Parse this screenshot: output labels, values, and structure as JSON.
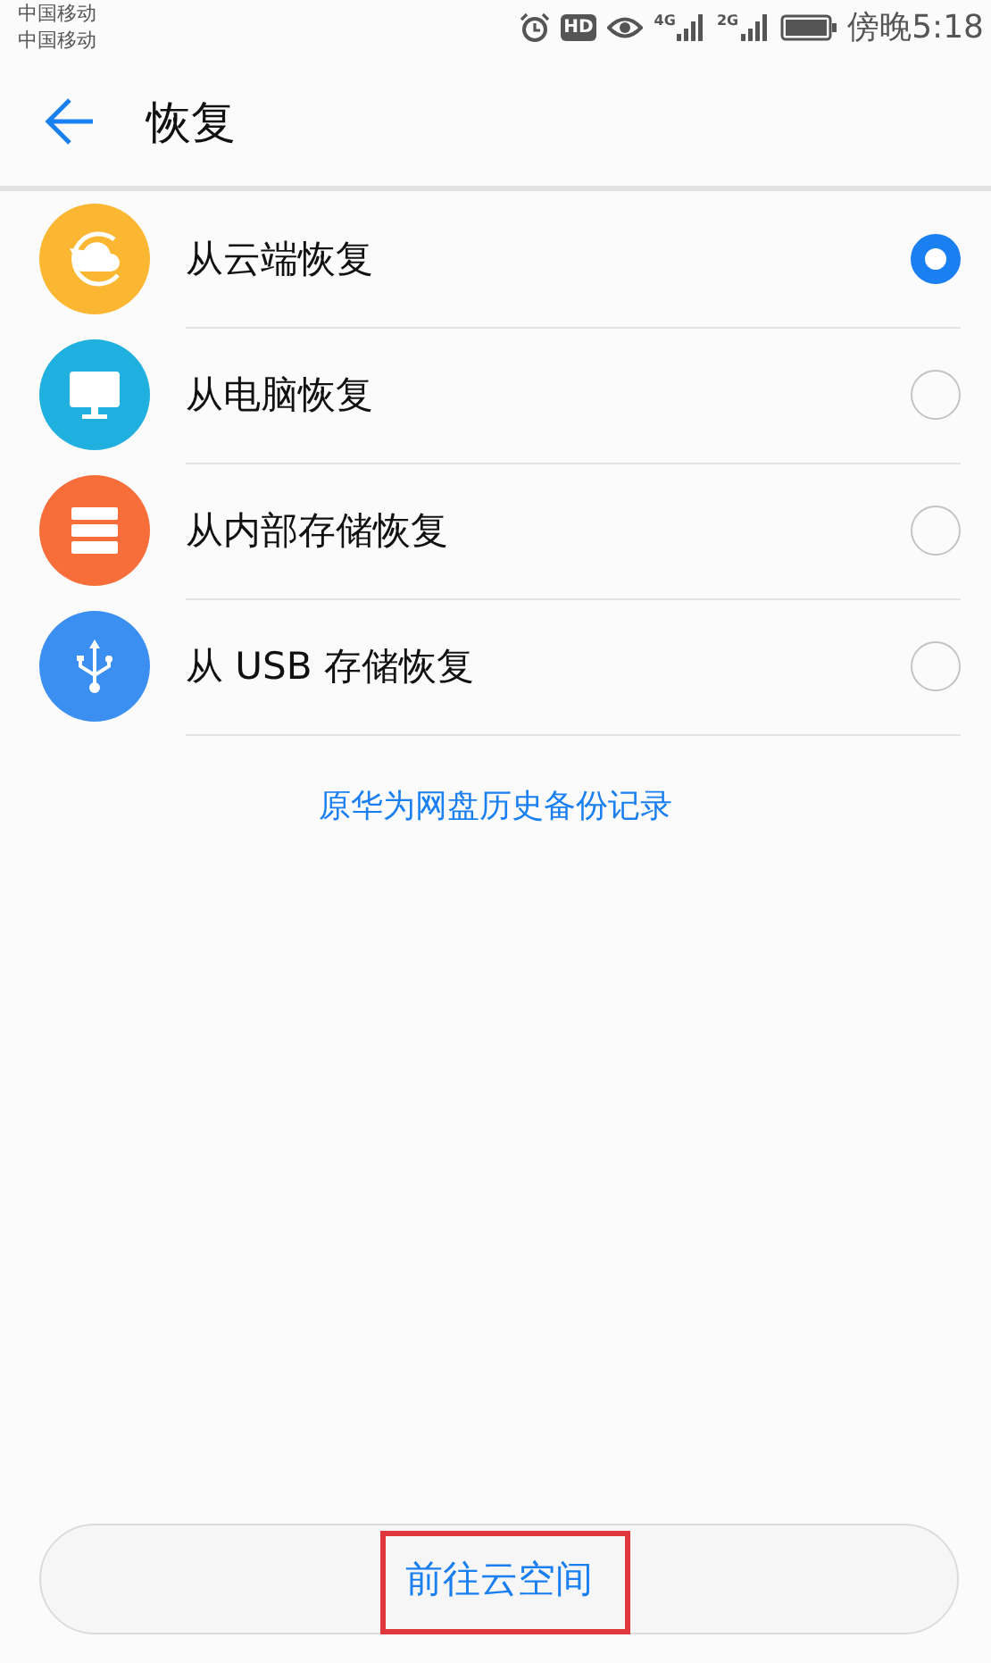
{
  "status_bar": {
    "carriers": [
      "中国移动",
      "中国移动"
    ],
    "hd": "HD",
    "networks": [
      {
        "label": "4G"
      },
      {
        "label": "2G"
      }
    ],
    "time": "傍晚5:18"
  },
  "header": {
    "title": "恢复"
  },
  "options": [
    {
      "kind": "cloud",
      "label": "从云端恢复",
      "color": "#fbb731",
      "selected": true
    },
    {
      "kind": "monitor",
      "label": "从电脑恢复",
      "color": "#1fb0e0",
      "selected": false
    },
    {
      "kind": "storage",
      "label": "从内部存储恢复",
      "color": "#f76e3a",
      "selected": false
    },
    {
      "kind": "usb",
      "label": "从 USB 存储恢复",
      "color": "#3a8ff1",
      "selected": false
    }
  ],
  "history_link": "原华为网盘历史备份记录",
  "bottom_button": {
    "label": "前往云空间",
    "highlighted": true
  }
}
